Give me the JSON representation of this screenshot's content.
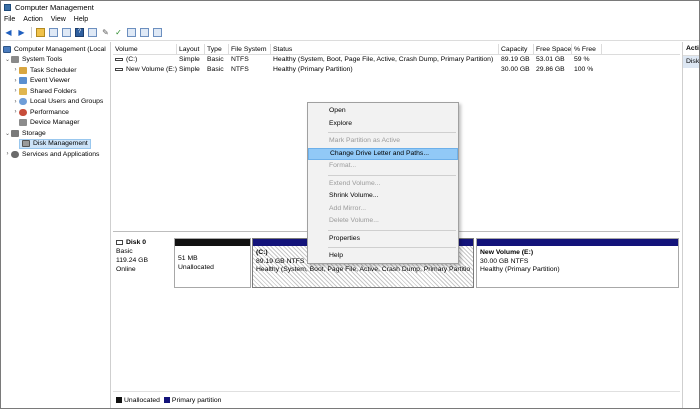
{
  "window": {
    "title": "Computer Management"
  },
  "menu": [
    "File",
    "Action",
    "View",
    "Help"
  ],
  "tree": {
    "root": "Computer Management (Local",
    "system_tools": "System Tools",
    "task_scheduler": "Task Scheduler",
    "event_viewer": "Event Viewer",
    "shared_folders": "Shared Folders",
    "local_users": "Local Users and Groups",
    "performance": "Performance",
    "device_manager": "Device Manager",
    "storage": "Storage",
    "disk_management": "Disk Management",
    "services": "Services and Applications"
  },
  "volumes": {
    "headers": [
      "Volume",
      "Layout",
      "Type",
      "File System",
      "Status",
      "Capacity",
      "Free Space",
      "% Free"
    ],
    "rows": [
      [
        "(C:)",
        "Simple",
        "Basic",
        "NTFS",
        "Healthy (System, Boot, Page File, Active, Crash Dump, Primary Partition)",
        "89.19 GB",
        "53.01 GB",
        "59 %"
      ],
      [
        "New Volume (E:)",
        "Simple",
        "Basic",
        "NTFS",
        "Healthy (Primary Partition)",
        "30.00 GB",
        "29.86 GB",
        "100 %"
      ]
    ]
  },
  "actions": {
    "header": "Acti",
    "sub": "Disk"
  },
  "disk": {
    "name": "Disk 0",
    "type": "Basic",
    "size": "119.24 GB",
    "state": "Online",
    "unallocated_size": "51 MB",
    "unallocated_label": "Unallocated",
    "c_name": "(C:)",
    "c_size": "89.19 GB NTFS",
    "c_status": "Healthy (System, Boot, Page File, Active, Crash Dump, Primary Partitio",
    "e_name": "New Volume  (E:)",
    "e_size": "30.00 GB NTFS",
    "e_status": "Healthy (Primary Partition)"
  },
  "legend": {
    "unallocated": "Unallocated",
    "primary": "Primary partition"
  },
  "context_menu": {
    "open": "Open",
    "explore": "Explore",
    "mark_active": "Mark Partition as Active",
    "change_letter": "Change Drive Letter and Paths...",
    "format": "Format...",
    "extend": "Extend Volume...",
    "shrink": "Shrink Volume...",
    "add_mirror": "Add Mirror...",
    "delete": "Delete Volume...",
    "properties": "Properties",
    "help": "Help"
  }
}
